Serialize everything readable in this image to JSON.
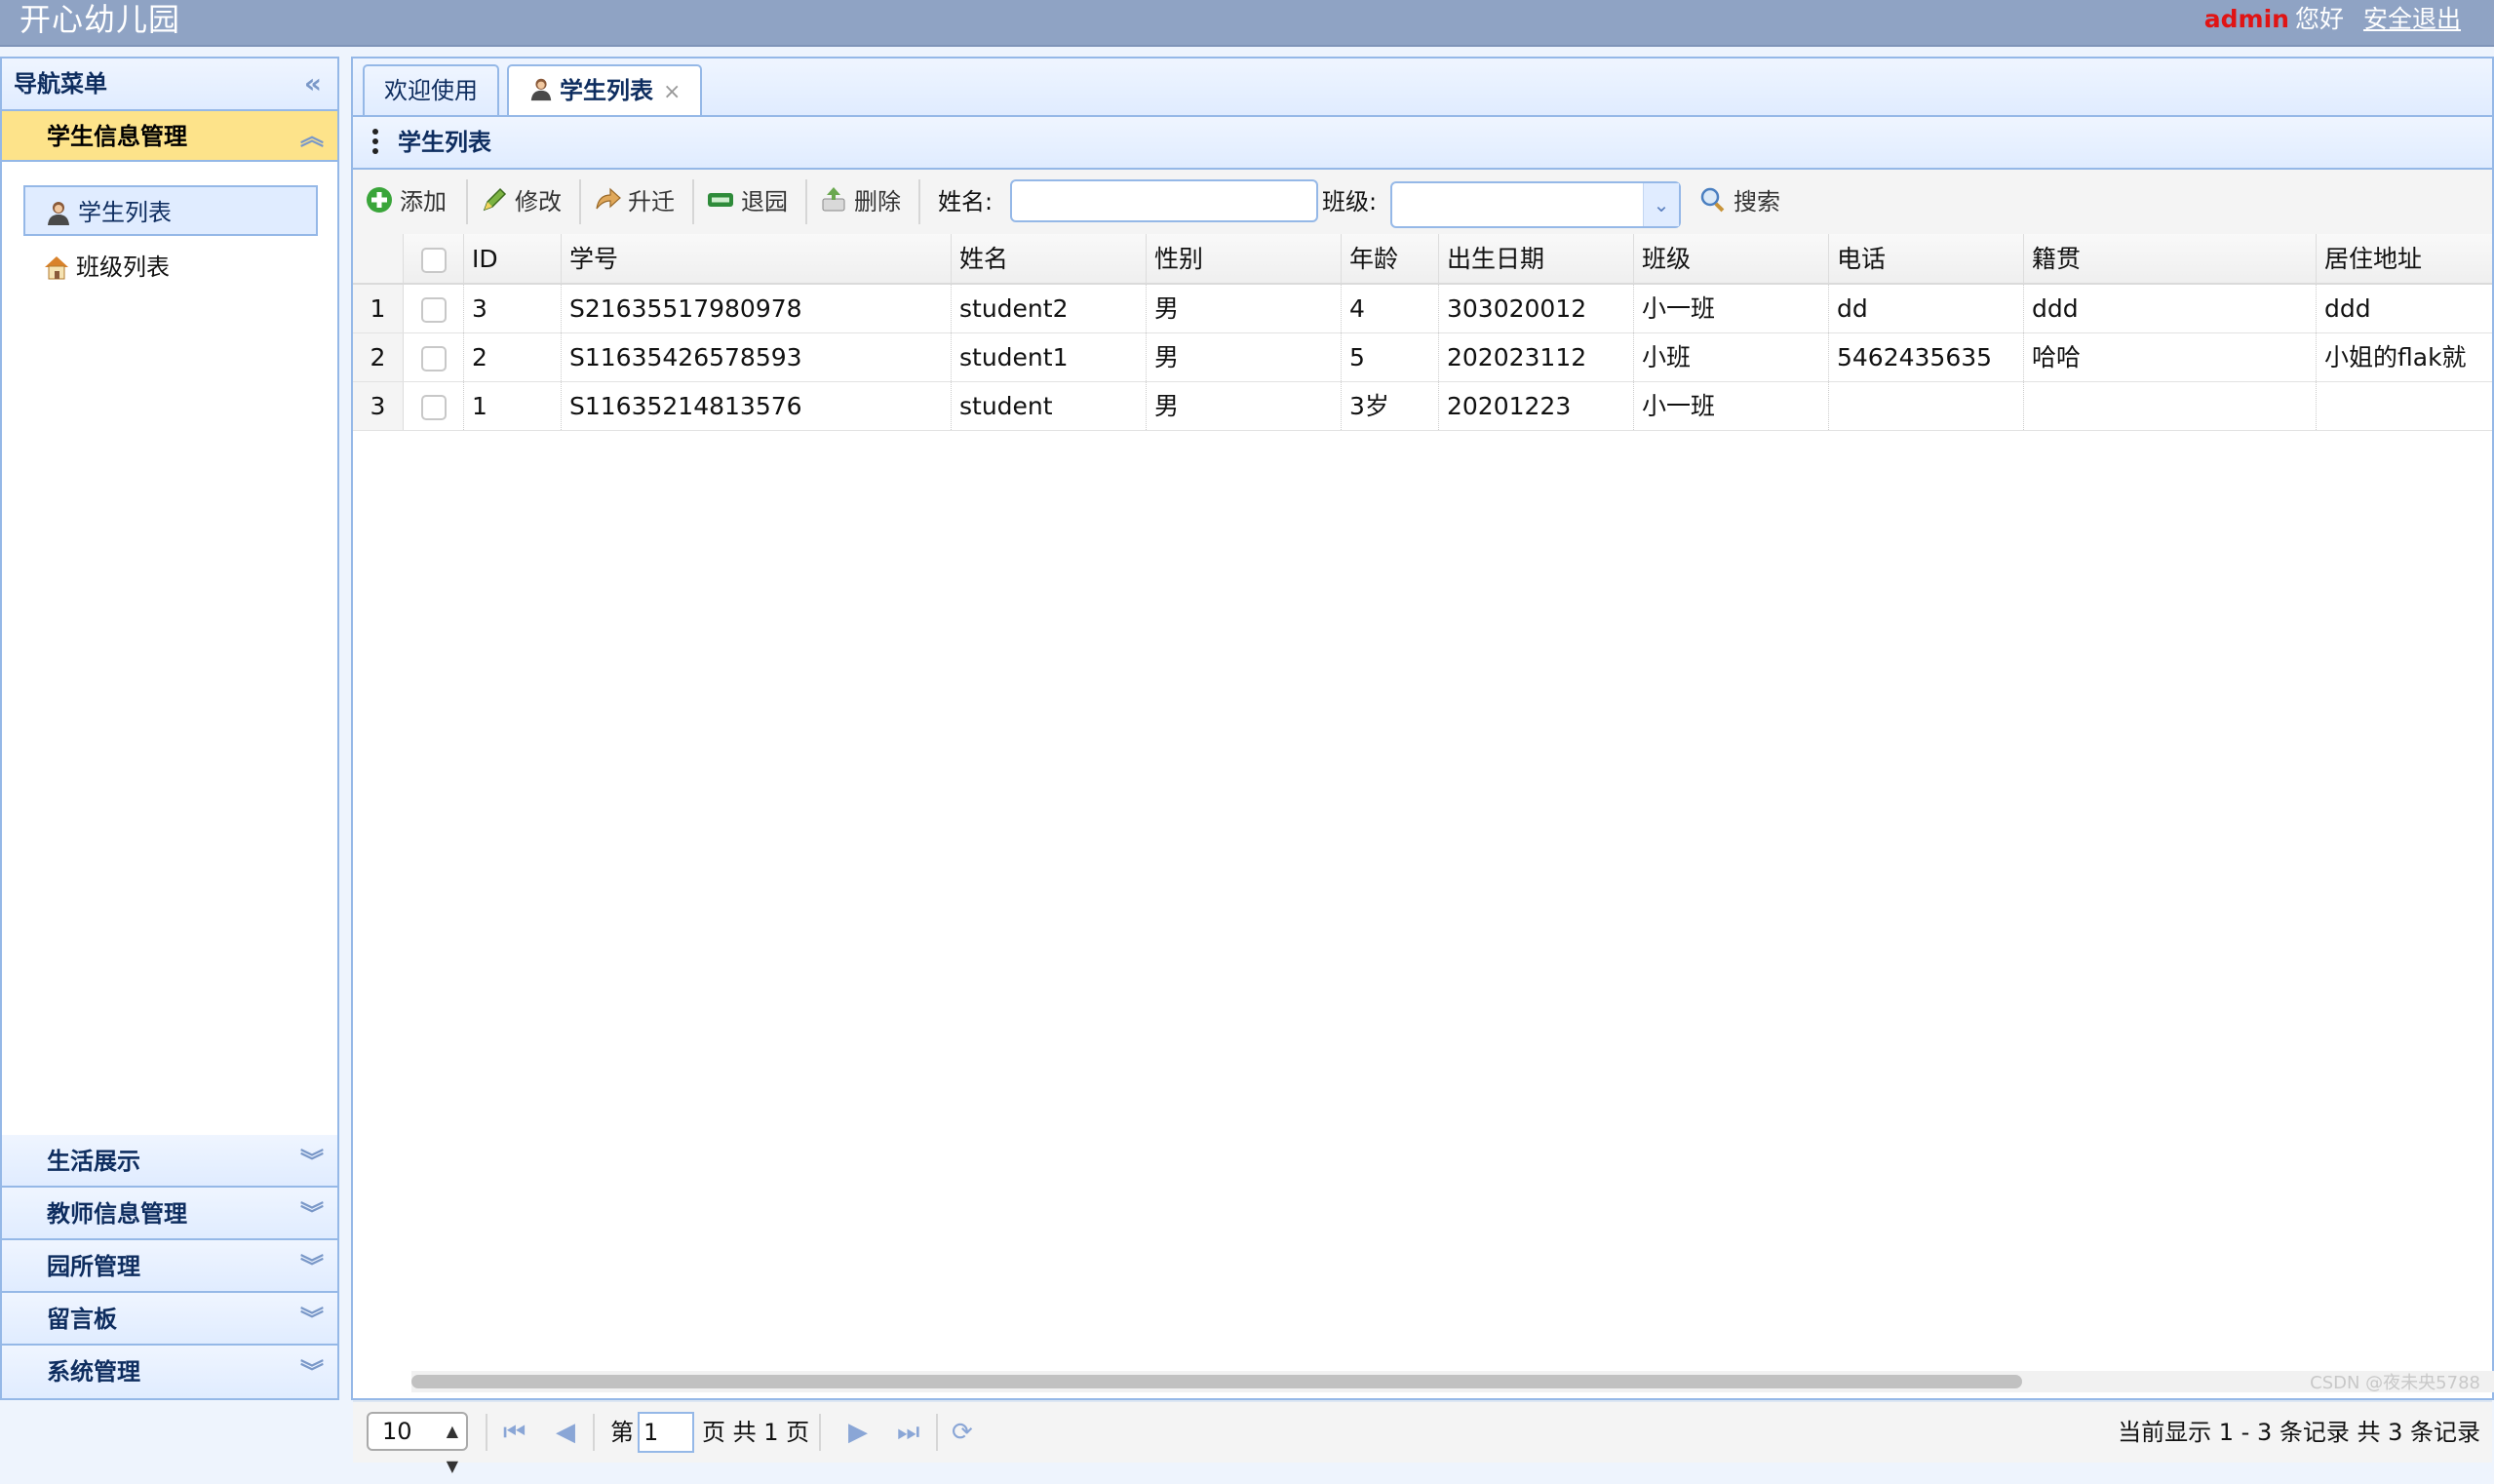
{
  "app": {
    "title": "开心幼儿园"
  },
  "user": {
    "name": "admin",
    "greeting": "您好",
    "logout": "安全退出"
  },
  "sidebar": {
    "title": "导航菜单",
    "active_group": "学生信息管理",
    "items": [
      {
        "label": "学生列表",
        "selected": true
      },
      {
        "label": "班级列表",
        "selected": false
      }
    ],
    "groups": [
      "生活展示",
      "教师信息管理",
      "园所管理",
      "留言板",
      "系统管理"
    ]
  },
  "tabs": [
    {
      "label": "欢迎使用",
      "active": false
    },
    {
      "label": "学生列表",
      "active": true,
      "close": "×"
    }
  ],
  "panel": {
    "title": "学生列表"
  },
  "toolbar": {
    "add": "添加",
    "edit": "修改",
    "promote": "升迁",
    "withdraw": "退园",
    "delete": "删除",
    "name_label": "姓名:",
    "class_label": "班级:",
    "search": "搜索",
    "name_value": "",
    "class_value": ""
  },
  "grid": {
    "columns": [
      "ID",
      "学号",
      "姓名",
      "性别",
      "年龄",
      "出生日期",
      "班级",
      "电话",
      "籍贯",
      "居住地址"
    ],
    "rows": [
      {
        "n": "1",
        "id": "3",
        "sno": "S21635517980978",
        "name": "student2",
        "sex": "男",
        "age": "4",
        "birth": "303020012",
        "cls": "小一班",
        "phone": "dd",
        "origin": "ddd",
        "addr": "ddd"
      },
      {
        "n": "2",
        "id": "2",
        "sno": "S11635426578593",
        "name": "student1",
        "sex": "男",
        "age": "5",
        "birth": "202023112",
        "cls": "小班",
        "phone": "5462435635",
        "origin": "哈哈",
        "addr": "小姐的flak就"
      },
      {
        "n": "3",
        "id": "1",
        "sno": "S11635214813576",
        "name": "student",
        "sex": "男",
        "age": "3岁",
        "birth": "20201223",
        "cls": "小一班",
        "phone": "",
        "origin": "",
        "addr": ""
      }
    ]
  },
  "pager": {
    "page_size": "10",
    "page_prefix": "第",
    "page_value": "1",
    "page_suffix": "页 共 1 页",
    "info": "当前显示 1 - 3 条记录 共 3 条记录"
  },
  "watermark": "CSDN @夜未央5788",
  "colors": {
    "topbar": "#8fa3c4",
    "accent_border": "#95b8e7",
    "active_accordion": "#fde38a",
    "username": "#e01414"
  }
}
